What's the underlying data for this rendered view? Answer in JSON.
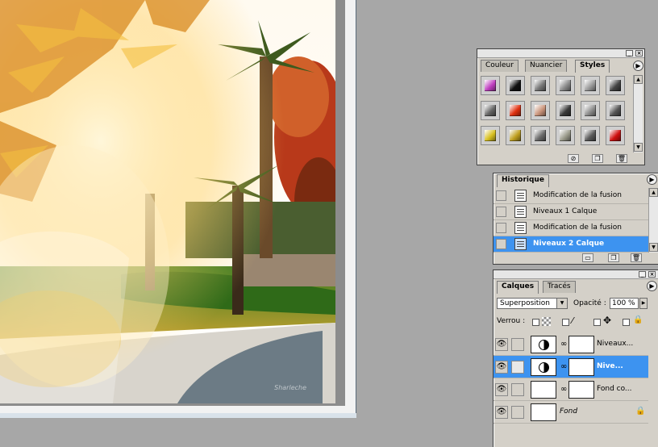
{
  "canvas": {
    "watermark": "Sharleche"
  },
  "styles_palette": {
    "tabs": [
      "Couleur",
      "Nuancier",
      "Styles"
    ],
    "active_tab": "Styles",
    "swatches": [
      {
        "icon": "rainbow-style-icon",
        "color": "#c040c0"
      },
      {
        "icon": "black-style-icon",
        "color": "#111111"
      },
      {
        "icon": "gray-bevel-style-icon",
        "color": "#777777"
      },
      {
        "icon": "gray-bevel-style-icon",
        "color": "#8a8a8a"
      },
      {
        "icon": "gray-emboss-style-icon",
        "color": "#9a9a9a"
      },
      {
        "icon": "texture-style-icon",
        "color": "#444444"
      },
      {
        "icon": "gray-shadow-style-icon",
        "color": "#666666"
      },
      {
        "icon": "red-glow-style-icon",
        "color": "#e03010"
      },
      {
        "icon": "skin-style-icon",
        "color": "#c9937a"
      },
      {
        "icon": "marble-style-icon",
        "color": "#3a3a3a"
      },
      {
        "icon": "gray-inset-style-icon",
        "color": "#8e8e8e"
      },
      {
        "icon": "dark-bevel-style-icon",
        "color": "#555555"
      },
      {
        "icon": "yellow-style-icon",
        "color": "#d8c020"
      },
      {
        "icon": "gold-style-icon",
        "color": "#c0a020"
      },
      {
        "icon": "slate-style-icon",
        "color": "#6a6a6a"
      },
      {
        "icon": "stone-style-icon",
        "color": "#9a9a8a"
      },
      {
        "icon": "pattern-style-icon",
        "color": "#5a5a5a"
      },
      {
        "icon": "red-style-icon",
        "color": "#d01010"
      }
    ]
  },
  "history_palette": {
    "tab": "Historique",
    "items": [
      {
        "label": "Modification de la fusion",
        "selected": false
      },
      {
        "label": "Niveaux 1 Calque",
        "selected": false
      },
      {
        "label": "Modification de la fusion",
        "selected": false
      },
      {
        "label": "Niveaux 2 Calque",
        "selected": true
      }
    ]
  },
  "layers_palette": {
    "tabs": [
      "Calques",
      "Tracés"
    ],
    "active_tab": "Calques",
    "blend_mode": "Superposition",
    "opacity_label": "Opacité :",
    "opacity_value": "100 %",
    "lock_label": "Verrou :",
    "layers": [
      {
        "name": "Niveaux...",
        "type": "adjustment",
        "selected": false
      },
      {
        "name": "Nive...",
        "type": "adjustment",
        "selected": true
      },
      {
        "name": "Fond co...",
        "type": "photo",
        "selected": false
      },
      {
        "name": "Fond",
        "type": "background",
        "selected": false,
        "locked": true
      }
    ]
  },
  "colors": {
    "selection": "#3d93f0",
    "panel": "#d4d0c8",
    "workspace": "#a7a7a7"
  }
}
